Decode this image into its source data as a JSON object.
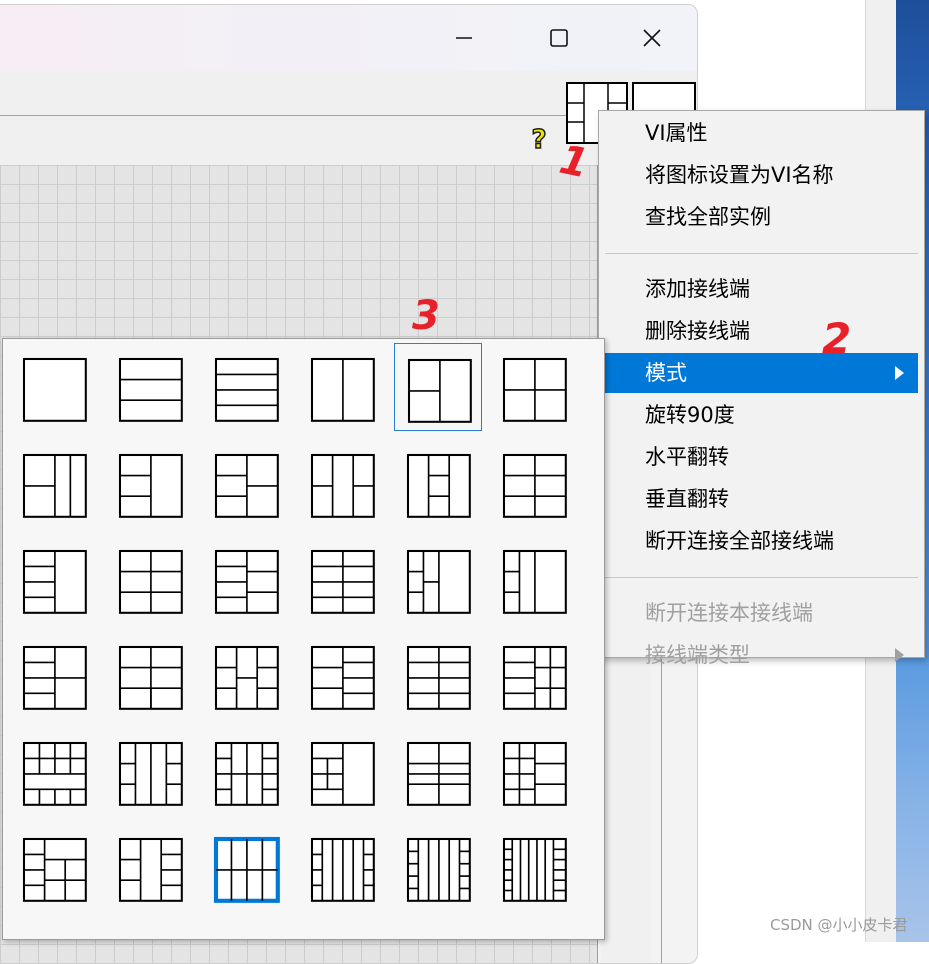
{
  "window": {
    "controls": [
      "minimize",
      "maximize",
      "close"
    ]
  },
  "context_menu": {
    "items": [
      {
        "label": "VI属性",
        "state": "normal"
      },
      {
        "label": "将图标设置为VI名称",
        "state": "normal"
      },
      {
        "label": "查找全部实例",
        "state": "normal"
      },
      {
        "separator": true
      },
      {
        "label": "添加接线端",
        "state": "normal"
      },
      {
        "label": "删除接线端",
        "state": "normal"
      },
      {
        "label": "模式",
        "state": "selected",
        "submenu": true
      },
      {
        "label": "旋转90度",
        "state": "normal"
      },
      {
        "label": "水平翻转",
        "state": "normal"
      },
      {
        "label": "垂直翻转",
        "state": "normal"
      },
      {
        "label": "断开连接全部接线端",
        "state": "normal"
      },
      {
        "separator": true
      },
      {
        "label": "断开连接本接线端",
        "state": "disabled"
      },
      {
        "label": "接线端类型",
        "state": "disabled",
        "submenu": true
      }
    ]
  },
  "annotations": {
    "step1": "1",
    "step2": "2",
    "step3": "3"
  },
  "palette": {
    "rows": 6,
    "cols": 6,
    "highlighted_cell": [
      0,
      4
    ],
    "selected_cell": [
      5,
      2
    ]
  },
  "icons": {
    "help": "question-mark-icon",
    "connector_pane": "connector-pane-icon",
    "vi_icon": "vi-icon"
  },
  "colors": {
    "menu_highlight": "#0078d7",
    "annotation": "#e8202a",
    "help_icon": "#f1e600"
  },
  "watermark": "CSDN @小小皮卡君"
}
